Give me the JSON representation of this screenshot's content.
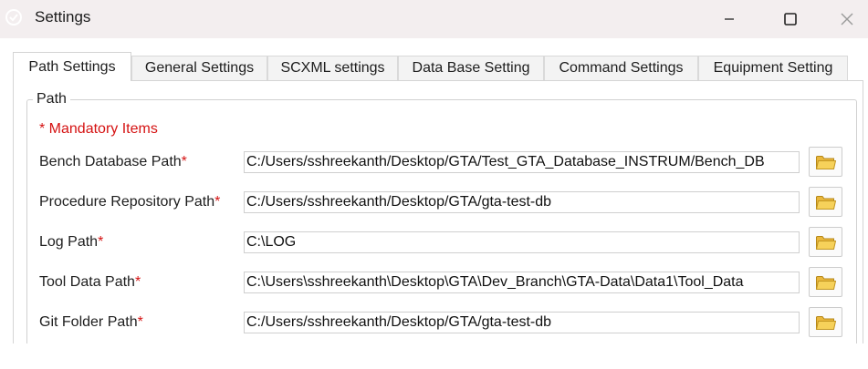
{
  "window": {
    "title": "Settings",
    "icon": "app-logo-icon",
    "controls": {
      "minimize_icon": "minimize-icon",
      "maximize_icon": "maximize-icon",
      "close_icon": "close-icon"
    }
  },
  "tabs": [
    {
      "label": "Path Settings",
      "active": true
    },
    {
      "label": "General Settings",
      "active": false
    },
    {
      "label": "SCXML settings",
      "active": false
    },
    {
      "label": "Data Base Setting",
      "active": false
    },
    {
      "label": "Command Settings",
      "active": false
    },
    {
      "label": "Equipment Setting",
      "active": false
    }
  ],
  "path_group": {
    "title": "Path",
    "mandatory_note": "* Mandatory Items",
    "rows": [
      {
        "label": "Bench Database Path",
        "required_marker": "*",
        "value": "C:/Users/sshreekanth/Desktop/GTA/Test_GTA_Database_INSTRUM/Bench_DB",
        "browse_icon": "folder-icon"
      },
      {
        "label": "Procedure Repository Path",
        "required_marker": "*",
        "value": "C:/Users/sshreekanth/Desktop/GTA/gta-test-db",
        "browse_icon": "folder-icon"
      },
      {
        "label": "Log Path",
        "required_marker": "*",
        "value": "C:\\LOG",
        "browse_icon": "folder-icon"
      },
      {
        "label": "Tool Data Path",
        "required_marker": "*",
        "value": "C:\\Users\\sshreekanth\\Desktop\\GTA\\Dev_Branch\\GTA-Data\\Data1\\Tool_Data",
        "browse_icon": "folder-icon"
      },
      {
        "label": "Git Folder Path",
        "required_marker": "*",
        "value": "C:/Users/sshreekanth/Desktop/GTA/gta-test-db",
        "browse_icon": "folder-icon"
      }
    ]
  },
  "colors": {
    "titlebar_bg": "#f3eeef",
    "required_red": "#d51313",
    "folder_yellow": "#f4c84a"
  }
}
